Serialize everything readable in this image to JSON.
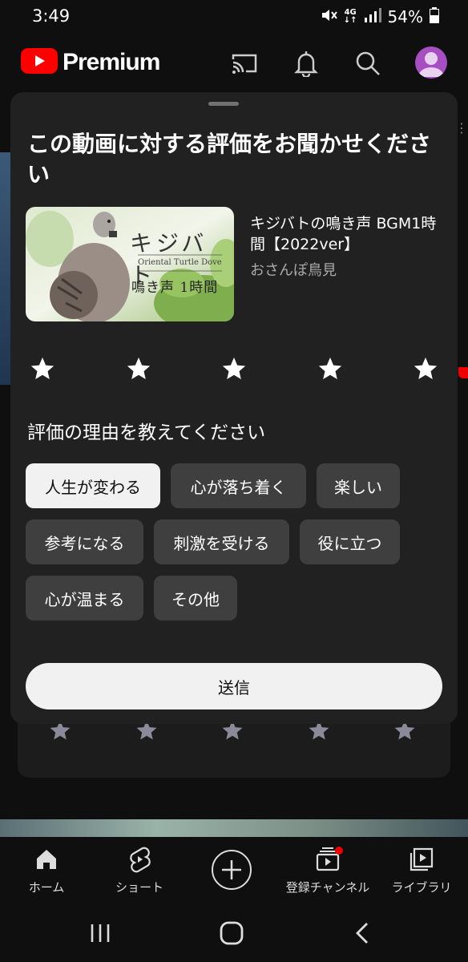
{
  "status_bar": {
    "time": "3:49",
    "network": "4G",
    "battery": "54%"
  },
  "app_bar": {
    "logo_text": "Premium",
    "icons": [
      "cast-icon",
      "bell-icon",
      "search-icon",
      "avatar"
    ],
    "brand_color": "#ff0000"
  },
  "sheet": {
    "title": "この動画に対する評価をお聞かせください",
    "video": {
      "title": "キジバトの鳴き声 BGM1時間【2022ver】",
      "channel": "おさんぽ鳥見",
      "thumbnail": {
        "title_jp": "キジバト",
        "subtitle_en": "Oriental Turtle Dove",
        "caption_jp": "鳴き声 1時間"
      }
    },
    "rating": {
      "max": 5,
      "value": 0
    },
    "reason_prompt": "評価の理由を教えてください",
    "chips": [
      [
        {
          "label": "人生が変わる",
          "selected": true
        },
        {
          "label": "心が落ち着く",
          "selected": false
        },
        {
          "label": "楽しい",
          "selected": false
        }
      ],
      [
        {
          "label": "参考になる",
          "selected": false
        },
        {
          "label": "刺激を受ける",
          "selected": false
        },
        {
          "label": "役に立つ",
          "selected": false
        }
      ],
      [
        {
          "label": "心が温まる",
          "selected": false
        },
        {
          "label": "その他",
          "selected": false
        }
      ]
    ],
    "submit_label": "送信"
  },
  "bottom_nav": {
    "items": [
      {
        "label": "ホーム",
        "icon": "home-icon"
      },
      {
        "label": "ショート",
        "icon": "shorts-icon"
      },
      {
        "label": "",
        "icon": "create-icon"
      },
      {
        "label": "登録チャンネル",
        "icon": "subscriptions-icon",
        "badge": true
      },
      {
        "label": "ライブラリ",
        "icon": "library-icon"
      }
    ]
  },
  "system_nav": {
    "icons": [
      "recent-apps-icon",
      "home-button-icon",
      "back-icon"
    ]
  }
}
